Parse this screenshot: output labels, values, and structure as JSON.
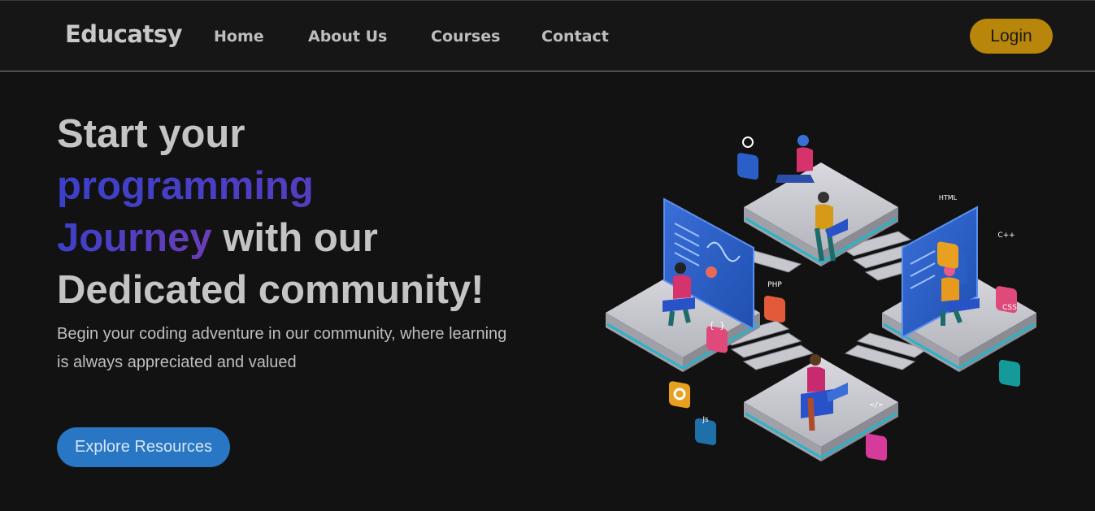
{
  "navbar": {
    "brand": "Educatsy",
    "links": [
      "Home",
      "About Us",
      "Courses",
      "Contact"
    ],
    "login_label": "Login"
  },
  "hero": {
    "title_part1": "Start your",
    "title_accent1": "programming",
    "title_accent2": "Journey",
    "title_part2": " with our",
    "title_part3": "Dedicated community!",
    "subtitle": "Begin your coding adventure in our community, where learning is always appreciated and valued",
    "cta_label": "Explore Resources"
  },
  "illustration": {
    "badges": [
      "HTML",
      "C++",
      "PHP",
      "CSS",
      "{ }",
      "</>",
      "Js"
    ]
  },
  "colors": {
    "background": "#121212",
    "navbar": "#161616",
    "accent_gradient_start": "#3b40c9",
    "accent_gradient_end": "#6a3db8",
    "login": "#b8860b",
    "cta": "#2876c4"
  }
}
